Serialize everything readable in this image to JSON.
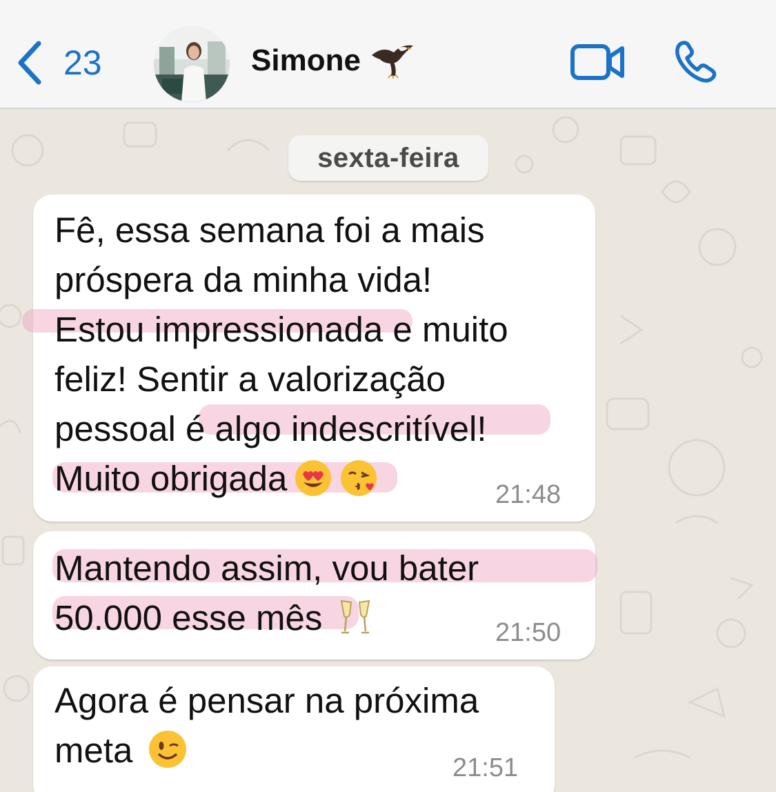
{
  "header": {
    "back_count": "23",
    "contact_name": "Simone",
    "icons": {
      "back": "chevron-left-icon",
      "name_emoji": "eagle-emoji-icon",
      "video": "video-call-icon",
      "call": "phone-icon"
    },
    "accent_color": "#1a73c8"
  },
  "chat": {
    "date_label": "sexta-feira",
    "messages": [
      {
        "lines": [
          "Fê, essa semana foi a mais",
          "próspera da minha vida!",
          "Estou impressionada e muito",
          "feliz! Sentir a valorização",
          "pessoal é algo indescritível!",
          "Muito obrigada"
        ],
        "emojis": [
          "heart-eyes-emoji-icon",
          "kiss-emoji-icon"
        ],
        "time": "21:48"
      },
      {
        "lines": [
          "Mantendo assim, vou bater",
          "50.000 esse mês"
        ],
        "emojis": [
          "champagne-glasses-emoji-icon"
        ],
        "time": "21:50"
      },
      {
        "lines": [
          "Agora é pensar na próxima",
          "meta"
        ],
        "emojis": [
          "wink-emoji-icon"
        ],
        "time": "21:51"
      }
    ],
    "highlight_color": "#ee9bb9"
  }
}
